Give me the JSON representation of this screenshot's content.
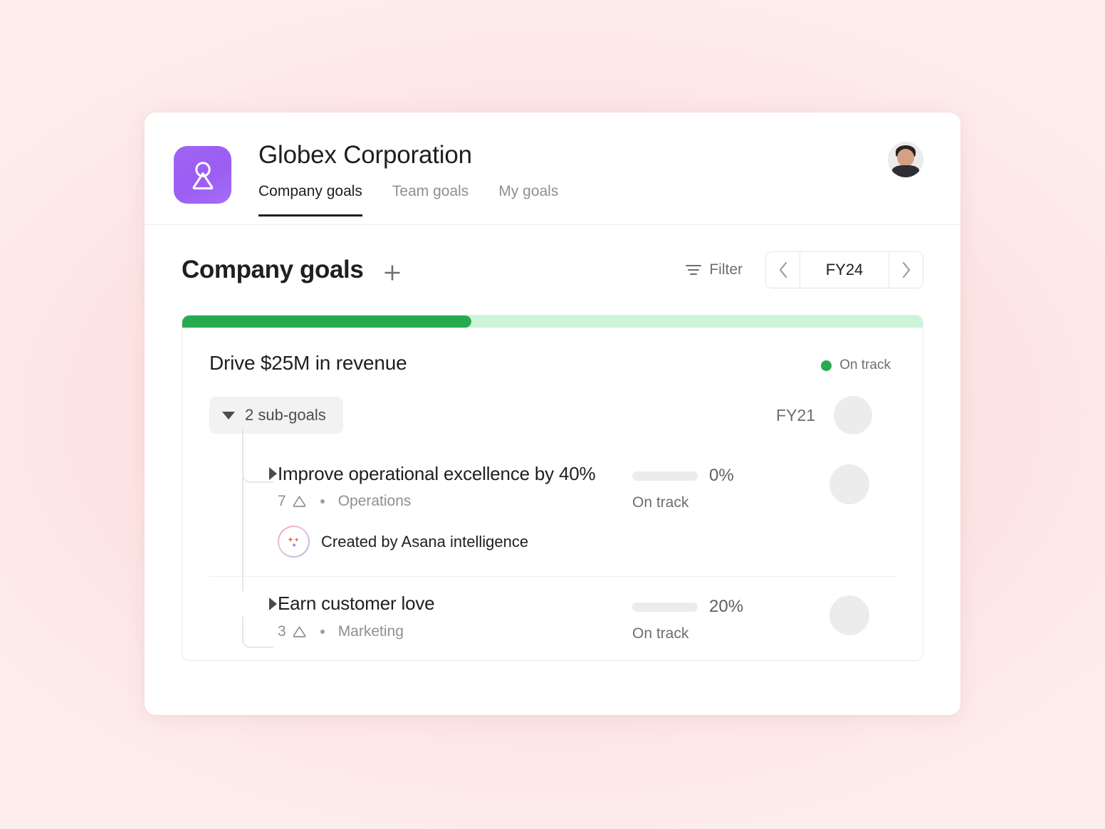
{
  "app": {
    "org_name": "Globex Corporation",
    "logo_icon": "person-avatar-icon",
    "logo_color": "#9b5df2",
    "header_avatar_name": "user-avatar"
  },
  "tabs": [
    {
      "label": "Company goals",
      "active": true
    },
    {
      "label": "Team goals",
      "active": false
    },
    {
      "label": "My goals",
      "active": false
    }
  ],
  "page": {
    "title": "Company goals",
    "add_button_icon": "plus-icon"
  },
  "controls": {
    "filter_label": "Filter",
    "filter_icon": "filter-icon",
    "prev_icon": "chevron-left-icon",
    "next_icon": "chevron-right-icon",
    "period_value": "FY24"
  },
  "goal": {
    "name": "Drive $25M in revenue",
    "progress_percent": 39,
    "status_label": "On track",
    "status_color": "#27ab50",
    "track_color": "#ccf4d9",
    "subgoals_toggle_label": "2 sub-goals",
    "time_period": "FY21",
    "owner_avatar_name": "goal-owner-avatar"
  },
  "subgoals": [
    {
      "title": "Improve operational excellence by 40%",
      "count": "7",
      "count_icon": "goal-triangle-icon",
      "team": "Operations",
      "progress_percent": 0,
      "progress_label": "0%",
      "status_label": "On track",
      "ai_credit": "Created by Asana intelligence",
      "ai_icon": "sparkles-icon",
      "avatar_name": "subgoal-owner-avatar"
    },
    {
      "title": "Earn customer love",
      "count": "3",
      "count_icon": "goal-triangle-icon",
      "team": "Marketing",
      "progress_percent": 20,
      "progress_label": "20%",
      "status_label": "On track",
      "ai_credit": "",
      "ai_icon": "",
      "avatar_name": "subgoal-owner-avatar"
    }
  ]
}
